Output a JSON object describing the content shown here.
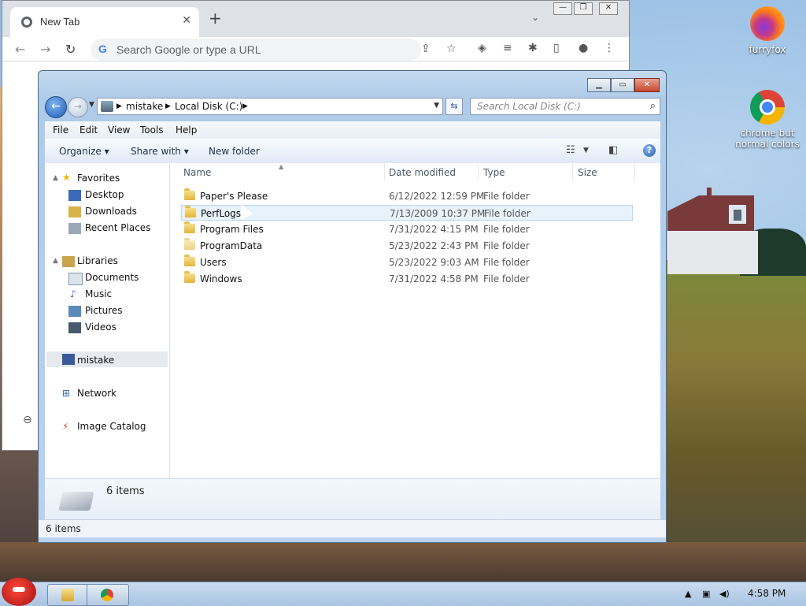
{
  "chrome": {
    "tab_title": "New Tab",
    "omnibox_placeholder": "Search Google or type a URL"
  },
  "explorer": {
    "address": {
      "crumbs": [
        "mistake",
        "Local Disk (C:)"
      ]
    },
    "search_placeholder": "Search Local Disk (C:)",
    "menu": [
      "File",
      "Edit",
      "View",
      "Tools",
      "Help"
    ],
    "toolbar": {
      "organize": "Organize",
      "share_with": "Share with",
      "new_folder": "New folder"
    },
    "nav": {
      "favorites": "Favorites",
      "favorites_items": [
        "Desktop",
        "Downloads",
        "Recent Places"
      ],
      "libraries": "Libraries",
      "libraries_items": [
        "Documents",
        "Music",
        "Pictures",
        "Videos"
      ],
      "computer": "mistake",
      "network": "Network",
      "image_catalog": "Image Catalog"
    },
    "columns": [
      "Name",
      "Date modified",
      "Type",
      "Size"
    ],
    "files": [
      {
        "name": "Paper's Please",
        "date": "6/12/2022 12:59 PM",
        "type": "File folder"
      },
      {
        "name": "PerfLogs",
        "date": "7/13/2009 10:37 PM",
        "type": "File folder"
      },
      {
        "name": "Program Files",
        "date": "7/31/2022 4:15 PM",
        "type": "File folder"
      },
      {
        "name": "ProgramData",
        "date": "5/23/2022 2:43 PM",
        "type": "File folder"
      },
      {
        "name": "Users",
        "date": "5/23/2022 9:03 AM",
        "type": "File folder"
      },
      {
        "name": "Windows",
        "date": "7/31/2022 4:58 PM",
        "type": "File folder"
      }
    ],
    "details_count": "6 items",
    "status": "6 items"
  },
  "desktop": {
    "icons": [
      "furryfox",
      "chrome but normal colors"
    ]
  },
  "taskbar": {
    "time": "4:58 PM"
  }
}
